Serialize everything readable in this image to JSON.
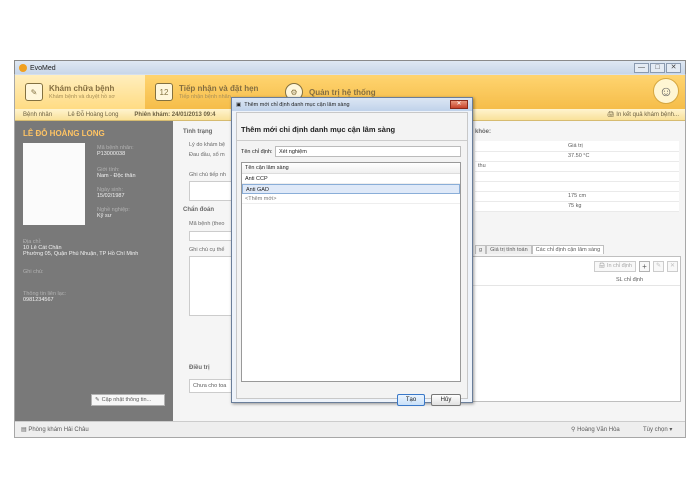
{
  "window": {
    "title": "EvoMed",
    "controls": [
      "—",
      "□",
      "✕"
    ]
  },
  "ribbon": {
    "tabs": [
      {
        "title": "Khám chữa bệnh",
        "subtitle": "Khám bệnh và duyệt hồ sơ",
        "icon": "edit-icon"
      },
      {
        "title": "Tiếp nhận và đặt hẹn",
        "subtitle": "Tiếp nhận bệnh nhân",
        "icon": "calendar-icon",
        "icon_text": "12"
      },
      {
        "title": "Quản trị hệ thống",
        "subtitle": "",
        "icon": "gear-icon"
      }
    ]
  },
  "breadcrumb": {
    "items": [
      "Bệnh nhân",
      "Lê Đỗ Hoàng Long",
      "Phiên khám: 24/01/2013 09:4"
    ],
    "right": "In kết quả khám bệnh..."
  },
  "patient": {
    "name": "LÊ ĐỖ HOÀNG LONG",
    "id_label": "Mã bệnh nhân:",
    "id": "P13000038",
    "sex_label": "Giới tính:",
    "sex": "Nam - Độc thân",
    "dob_label": "Ngày sinh:",
    "dob": "15/02/1987",
    "job_label": "Nghề nghiệp:",
    "job": "Kỹ sư",
    "addr_label": "Địa chỉ:",
    "addr1": "10 Lê Cát Chân",
    "addr2": "Phường 05, Quận Phú Nhuận, TP Hồ Chí Minh",
    "note_label": "Ghi chú:",
    "contact_label": "Thông tin liên lạc:",
    "phone": "0981234567",
    "update_button": "Cập nhật thông tin..."
  },
  "center": {
    "status_title": "Tình trạng",
    "reason_label": "Lý do khám bệ",
    "reason_value": "Đau đầu, sổ m",
    "next_note_label": "Ghi chú tiếp nh",
    "diagnosis_title": "Chẩn đoán",
    "disease_label": "Mã bệnh (theo",
    "detail_note_label": "Ghi chú cụ thể",
    "treatment_title": "Điều trị",
    "treatment_value": "Chưa cho toa"
  },
  "right": {
    "vitals_title": "khỏe:",
    "col_value": "Giá trị",
    "rows": [
      {
        "name": "",
        "value": "37.50 °C"
      },
      {
        "name": "thu",
        "value": ""
      },
      {
        "name": "",
        "value": ""
      },
      {
        "name": "",
        "value": ""
      },
      {
        "name": "",
        "value": "175 cm"
      },
      {
        "name": "",
        "value": "75 kg"
      }
    ],
    "tabs": [
      "g",
      "Giá trị tính toán",
      "Các chỉ định cận lâm sàng"
    ],
    "print_button": "In chỉ định",
    "col_sl": "SL chỉ định"
  },
  "status": {
    "clinic": "Phòng khám Hải Châu",
    "user": "Hoàng Văn Hòa",
    "options": "Tùy chọn"
  },
  "dialog": {
    "title": "Thêm mới chỉ định danh mục cận lâm sàng",
    "heading": "Thêm mới chỉ định danh mục cận lâm sàng",
    "field_label": "Tên chỉ định:",
    "field_value": "Xét nghiệm",
    "list_header": "Tên cận lâm sàng",
    "items": [
      "Anti CCP",
      "Anti GAD",
      "<Thêm mới>"
    ],
    "create_button": "Tạo",
    "cancel_button": "Hủy"
  }
}
